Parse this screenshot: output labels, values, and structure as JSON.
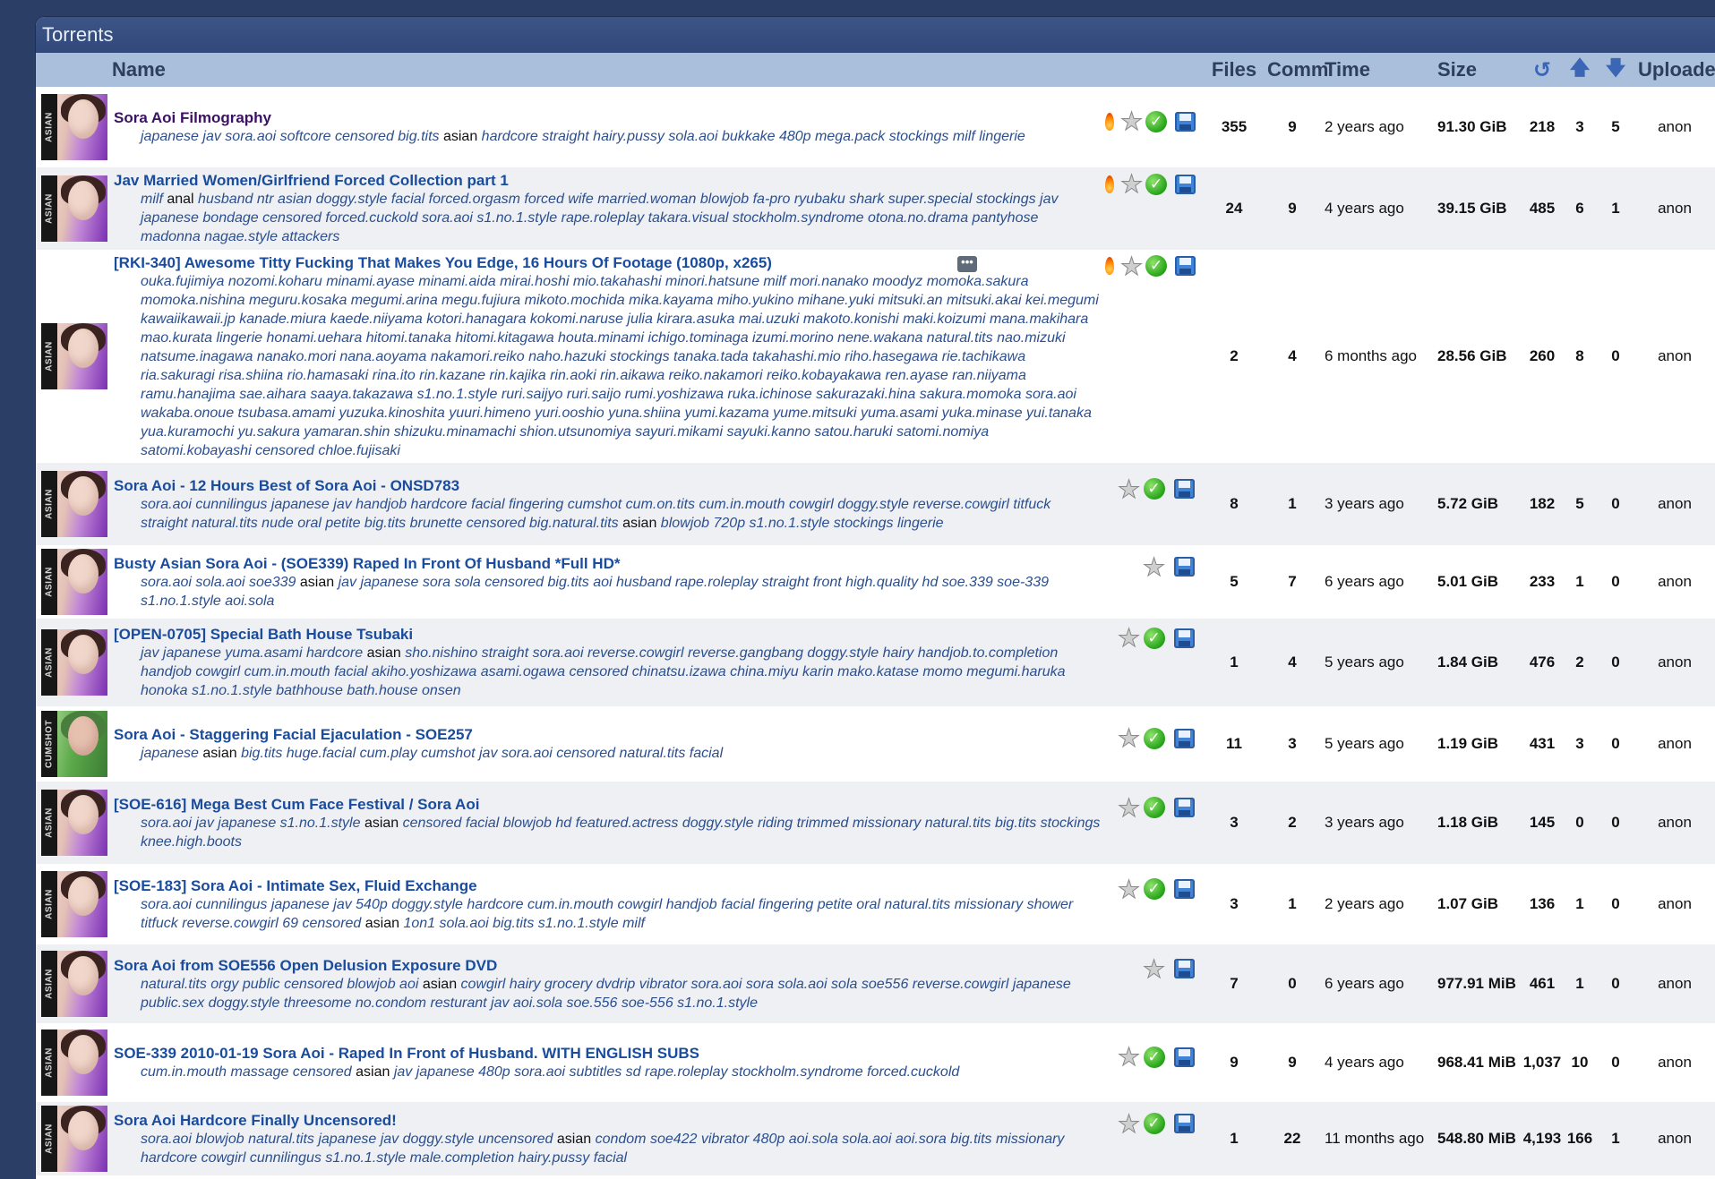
{
  "panel_title": "Torrents",
  "columns": {
    "name": "Name",
    "files": "Files",
    "comments": "Comm",
    "time": "Time",
    "size": "Size",
    "completed_icon": "refresh-icon",
    "seeders_icon": "arrow-up-icon",
    "leechers_icon": "arrow-down-icon",
    "uploader": "Uploader"
  },
  "rows": [
    {
      "category": "ASIAN",
      "title": "Sora Aoi Filmography",
      "visited": true,
      "tags_before": "japanese jav sora.aoi softcore censored big.tits ",
      "tag_highlight": "asian",
      "tags_after": " hardcore straight hairy.pussy sola.aoi bukkake 480p mega.pack stockings milf lingerie",
      "flame": true,
      "check": true,
      "files": "355",
      "comments": "9",
      "time": "2 years ago",
      "size": "91.30 GiB",
      "completed": "218",
      "seeders": "3",
      "leechers": "5",
      "uploader": "anon"
    },
    {
      "category": "ASIAN",
      "title": "Jav Married Women/Girlfriend Forced Collection part 1",
      "visited": false,
      "tags_before": "milf ",
      "tag_highlight": "anal",
      "tags_after": " husband ntr asian doggy.style facial forced.orgasm forced wife married.woman blowjob fa-pro ryubaku shark super.special stockings jav japanese bondage censored forced.cuckold sora.aoi s1.no.1.style rape.roleplay takara.visual stockholm.syndrome otona.no.drama pantyhose madonna nagae.style attackers",
      "flame": true,
      "check": true,
      "files": "24",
      "comments": "9",
      "time": "4 years ago",
      "size": "39.15 GiB",
      "completed": "485",
      "seeders": "6",
      "leechers": "1",
      "uploader": "anon"
    },
    {
      "category": "ASIAN",
      "title": "[RKI-340] Awesome Titty Fucking That Makes You Edge, 16 Hours Of Footage (1080p, x265)",
      "visited": false,
      "tags_before": "ouka.fujimiya nozomi.koharu minami.ayase minami.aida mirai.hoshi mio.takahashi minori.hatsune milf mori.nanako moodyz momoka.sakura momoka.nishina meguru.kosaka megumi.arina megu.fujiura mikoto.mochida mika.kayama miho.yukino mihane.yuki mitsuki.an mitsuki.akai kei.megumi kawaiikawaii.jp kanade.miura kaede.niiyama kotori.hanagara kokomi.naruse julia kirara.asuka mai.uzuki makoto.konishi maki.koizumi mana.makihara mao.kurata lingerie honami.uehara hitomi.tanaka hitomi.kitagawa houta.minami ichigo.tominaga izumi.morino nene.wakana natural.tits nao.mizuki natsume.inagawa nanako.mori nana.aoyama nakamori.reiko naho.hazuki stockings tanaka.tada takahashi.mio riho.hasegawa rie.tachikawa ria.sakuragi risa.shiina rio.hamasaki rina.ito rin.kazane rin.kajika rin.aoki rin.aikawa reiko.nakamori reiko.kobayakawa ren.ayase ran.niiyama ramu.hanajima sae.aihara saaya.takazawa s1.no.1.style ruri.saijyo ruri.saijo rumi.yoshizawa ruka.ichinose sakurazaki.hina sakura.momoka sora.aoi wakaba.onoue tsubasa.amami yuzuka.kinoshita yuuri.himeno yuri.ooshio yuna.shiina yumi.kazama yume.mitsuki yuma.asami yuka.minase yui.tanaka yua.kuramochi yu.sakura yamaran.shin shizuku.minamachi shion.utsunomiya sayuri.mikami sayuki.kanno satou.haruki satomi.nomiya satomi.kobayashi censored chloe.fujisaki",
      "tag_highlight": "",
      "tags_after": "",
      "flame": true,
      "check": true,
      "files": "2",
      "comments": "4",
      "time": "6 months ago",
      "size": "28.56 GiB",
      "completed": "260",
      "seeders": "8",
      "leechers": "0",
      "uploader": "anon"
    },
    {
      "category": "ASIAN",
      "title": "Sora Aoi - 12 Hours Best of Sora Aoi - ONSD783",
      "visited": false,
      "tags_before": "sora.aoi cunnilingus japanese jav handjob hardcore facial fingering cumshot cum.on.tits cum.in.mouth cowgirl doggy.style reverse.cowgirl titfuck straight natural.tits nude oral petite big.tits brunette censored big.natural.tits ",
      "tag_highlight": "asian",
      "tags_after": " blowjob 720p s1.no.1.style stockings lingerie",
      "flame": false,
      "check": true,
      "files": "8",
      "comments": "1",
      "time": "3 years ago",
      "size": "5.72 GiB",
      "completed": "182",
      "seeders": "5",
      "leechers": "0",
      "uploader": "anon"
    },
    {
      "category": "ASIAN",
      "title": "Busty Asian Sora Aoi - (SOE339) Raped In Front Of Husband *Full HD*",
      "visited": false,
      "tags_before": "sora.aoi sola.aoi soe339 ",
      "tag_highlight": "asian",
      "tags_after": " jav japanese sora sola censored big.tits aoi husband rape.roleplay straight front high.quality hd soe.339 soe-339 s1.no.1.style aoi.sola",
      "flame": false,
      "check": false,
      "files": "5",
      "comments": "7",
      "time": "6 years ago",
      "size": "5.01 GiB",
      "completed": "233",
      "seeders": "1",
      "leechers": "0",
      "uploader": "anon"
    },
    {
      "category": "ASIAN",
      "title": "[OPEN-0705] Special Bath House Tsubaki",
      "visited": false,
      "tags_before": "jav japanese yuma.asami hardcore ",
      "tag_highlight": "asian",
      "tags_after": " sho.nishino straight sora.aoi reverse.cowgirl reverse.gangbang doggy.style hairy handjob.to.completion handjob cowgirl cum.in.mouth facial akiho.yoshizawa asami.ogawa censored chinatsu.izawa china.miyu karin mako.katase momo megumi.haruka honoka s1.no.1.style bathhouse bath.house onsen",
      "flame": false,
      "check": true,
      "files": "1",
      "comments": "4",
      "time": "5 years ago",
      "size": "1.84 GiB",
      "completed": "476",
      "seeders": "2",
      "leechers": "0",
      "uploader": "anon"
    },
    {
      "category": "CUMSHOT",
      "title": "Sora Aoi - Staggering Facial Ejaculation - SOE257",
      "visited": false,
      "tags_before": "japanese ",
      "tag_highlight": "asian",
      "tags_after": " big.tits huge.facial cum.play cumshot jav sora.aoi censored natural.tits facial",
      "flame": false,
      "check": true,
      "files": "11",
      "comments": "3",
      "time": "5 years ago",
      "size": "1.19 GiB",
      "completed": "431",
      "seeders": "3",
      "leechers": "0",
      "uploader": "anon"
    },
    {
      "category": "ASIAN",
      "title": "[SOE-616] Mega Best Cum Face Festival / Sora Aoi",
      "visited": false,
      "tags_before": "sora.aoi jav japanese s1.no.1.style ",
      "tag_highlight": "asian",
      "tags_after": " censored facial blowjob hd featured.actress doggy.style riding trimmed missionary natural.tits big.tits stockings knee.high.boots",
      "flame": false,
      "check": true,
      "files": "3",
      "comments": "2",
      "time": "3 years ago",
      "size": "1.18 GiB",
      "completed": "145",
      "seeders": "0",
      "seeders_red": true,
      "leechers": "0",
      "uploader": "anon"
    },
    {
      "category": "ASIAN",
      "title": "[SOE-183] Sora Aoi - Intimate Sex, Fluid Exchange",
      "visited": false,
      "tags_before": "sora.aoi cunnilingus japanese jav 540p doggy.style hardcore cum.in.mouth cowgirl handjob facial fingering petite oral natural.tits missionary shower titfuck reverse.cowgirl 69 censored ",
      "tag_highlight": "asian",
      "tags_after": " 1on1 sola.aoi big.tits s1.no.1.style milf",
      "flame": false,
      "check": true,
      "files": "3",
      "comments": "1",
      "time": "2 years ago",
      "size": "1.07 GiB",
      "completed": "136",
      "seeders": "1",
      "leechers": "0",
      "uploader": "anon"
    },
    {
      "category": "ASIAN",
      "title": "Sora Aoi from SOE556 Open Delusion Exposure DVD",
      "visited": false,
      "tags_before": "natural.tits orgy public censored blowjob aoi ",
      "tag_highlight": "asian",
      "tags_after": " cowgirl hairy grocery dvdrip vibrator sora.aoi sora sola.aoi sola soe556 reverse.cowgirl japanese public.sex doggy.style threesome no.condom resturant jav aoi.sola soe.556 soe-556 s1.no.1.style",
      "flame": false,
      "check": false,
      "files": "7",
      "comments": "0",
      "time": "6 years ago",
      "size": "977.91 MiB",
      "completed": "461",
      "seeders": "1",
      "leechers": "0",
      "uploader": "anon"
    },
    {
      "category": "ASIAN",
      "title": "SOE-339 2010-01-19 Sora Aoi - Raped In Front of Husband. WITH ENGLISH SUBS",
      "visited": false,
      "tags_before": "cum.in.mouth massage censored ",
      "tag_highlight": "asian",
      "tags_after": " jav japanese 480p sora.aoi subtitles sd rape.roleplay stockholm.syndrome forced.cuckold",
      "flame": false,
      "check": true,
      "files": "9",
      "comments": "9",
      "time": "4 years ago",
      "size": "968.41 MiB",
      "completed": "1,037",
      "seeders": "10",
      "leechers": "0",
      "uploader": "anon"
    },
    {
      "category": "ASIAN",
      "title": "Sora Aoi Hardcore Finally Uncensored!",
      "visited": false,
      "tags_before": "sora.aoi blowjob natural.tits japanese jav doggy.style uncensored ",
      "tag_highlight": "asian",
      "tags_after": " condom soe422 vibrator 480p aoi.sola sola.aoi aoi.sora big.tits missionary hardcore cowgirl cunnilingus s1.no.1.style male.completion hairy.pussy facial",
      "flame": false,
      "check": true,
      "files": "1",
      "comments": "22",
      "time": "11 months ago",
      "size": "548.80 MiB",
      "completed": "4,193",
      "seeders": "166",
      "leechers": "1",
      "uploader": "anon"
    }
  ]
}
